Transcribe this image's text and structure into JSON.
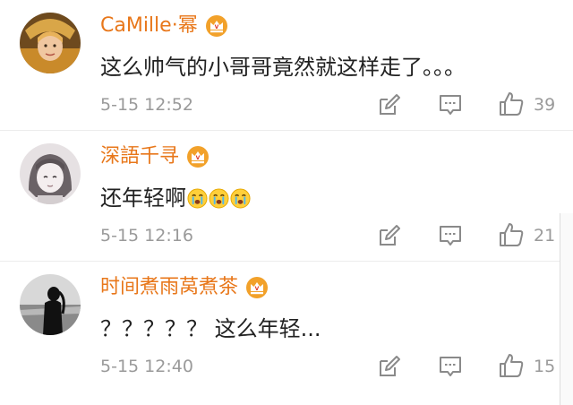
{
  "theme": {
    "username_color": "#e8771a",
    "text_color": "#222222",
    "meta_color": "#9a9a9a",
    "divider_color": "#ececec",
    "vip_badge_color": "#f2a12a"
  },
  "comments": [
    {
      "username": "CaMille·幂",
      "badge_icon": "vip-crown-icon",
      "text": "这么帅气的小哥哥竟然就这样走了。。。",
      "emojis": [],
      "time": "5-15 12:52",
      "likes": "39"
    },
    {
      "username": "深語千寻",
      "badge_icon": "vip-crown-icon",
      "text": "还年轻啊",
      "emojis": [
        "crying-emoji",
        "crying-emoji",
        "crying-emoji"
      ],
      "time": "5-15 12:16",
      "likes": "21"
    },
    {
      "username": "时间煮雨莴煮茶",
      "badge_icon": "vip-crown-icon",
      "text": "？？？？？ 这么年轻...",
      "emojis": [],
      "time": "5-15 12:40",
      "likes": "15"
    }
  ],
  "actions": {
    "share_icon": "share-edit-icon",
    "reply_icon": "comment-icon",
    "like_icon": "thumbs-up-icon"
  }
}
